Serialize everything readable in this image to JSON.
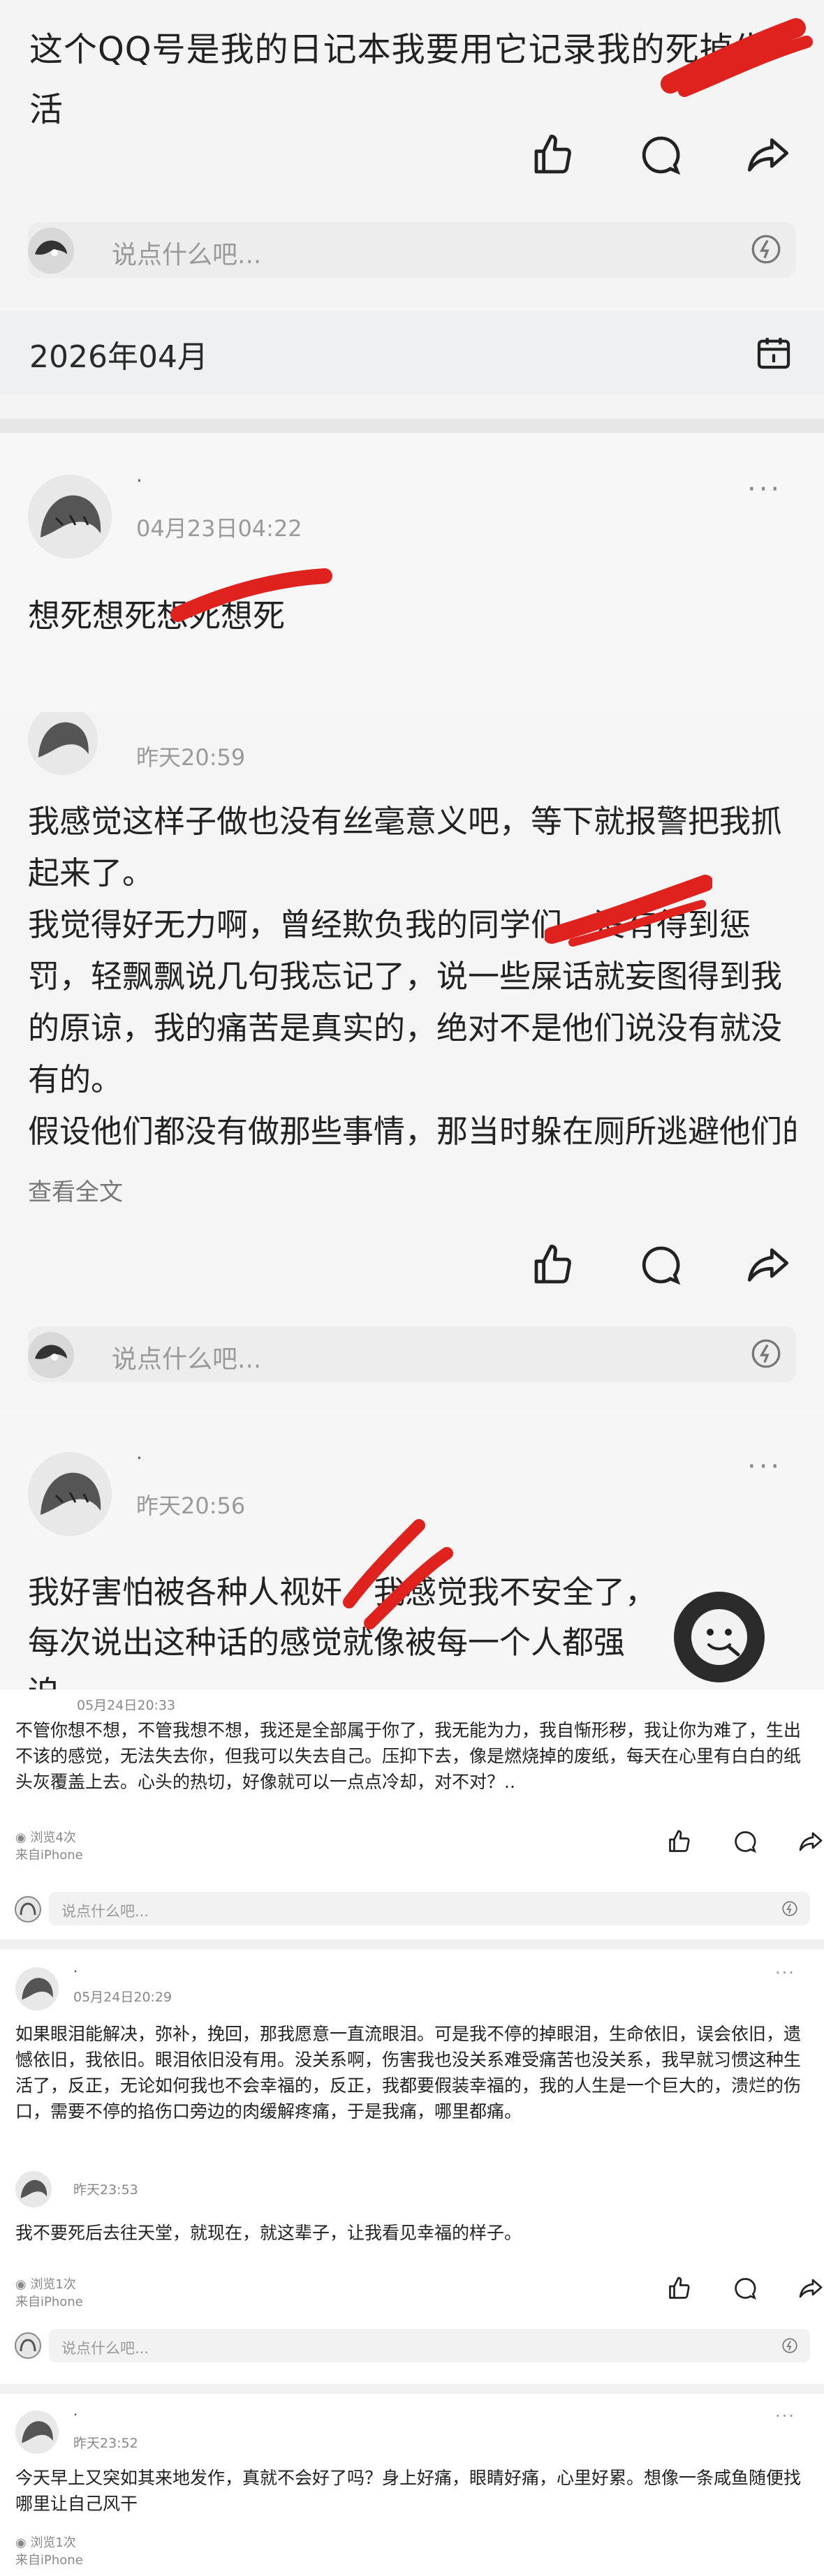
{
  "top": {
    "text": "这个QQ号是我的日记本我要用它记录我的死掉生活",
    "comment_placeholder": "说点什么吧...",
    "month": "2026年04月"
  },
  "post1": {
    "name": "·",
    "time": "04月23日04:22",
    "text": "想死想死想死想死",
    "more": "···"
  },
  "post2": {
    "time": "昨天20:59",
    "paragraphs": [
      "我感觉这样子做也没有丝毫意义吧，等下就报警把我抓起来了。",
      "我觉得好无力啊，曾经欺负我的同学们，没有得到惩罚，轻飘飘说几句我忘记了，说一些屎话就妄图得到我的原谅，我的痛苦是真实的，绝对不是他们说没有就没有的。",
      "假设他们都没有做那些事情，那当时躲在厕所逃避他们的言语攻击的人难道不是我啊，真是受..."
    ],
    "see_all": "查看全文",
    "comment_placeholder": "说点什么吧..."
  },
  "post3": {
    "name": "·",
    "time": "昨天20:56",
    "text": "我好害怕被各种人视奸，我感觉我不安全了，每次说出这种话的感觉就像被每一个人都强迫。",
    "more": "···"
  },
  "posts_small": [
    {
      "time": "05月24日20:33",
      "text": "不管你想不想，不管我想不想，我还是全部属于你了，我无能为力，我自惭形秽，我让你为难了，生出不该的感觉，无法失去你，但我可以失去自己。压抑下去，像是燃烧掉的废纸，每天在心里有白白的纸头灰覆盖上去。心头的热切，好像就可以一点点冷却，对不对？..",
      "views": "浏览4次",
      "source": "来自iPhone",
      "comment_placeholder": "说点什么吧..."
    },
    {
      "name": "·",
      "time": "05月24日20:29",
      "text": "如果眼泪能解决，弥补，挽回，那我愿意一直流眼泪。可是我不停的掉眼泪，生命依旧，误会依旧，遗憾依旧，我依旧。眼泪依旧没有用。没关系啊，伤害我也没关系难受痛苦也没关系，我早就习惯这种生活了，反正，无论如何我也不会幸福的，反正，我都要假装幸福的，我的人生是一个巨大的，溃烂的伤口，需要不停的掐伤口旁边的肉缓解疼痛，于是我痛，哪里都痛。",
      "more": "···"
    },
    {
      "time": "昨天23:53",
      "text": "我不要死后去往天堂，就现在，就这辈子，让我看见幸福的样子。",
      "views": "浏览1次",
      "source": "来自iPhone",
      "comment_placeholder": "说点什么吧..."
    },
    {
      "name": "·",
      "time": "昨天23:52",
      "text": "今天早上又突如其来地发作，真就不会好了吗？身上好痛，眼睛好痛，心里好累。想像一条咸鱼随便找哪里让自己风干",
      "views": "浏览1次",
      "source": "来自iPhone",
      "more": "···"
    }
  ],
  "icons": [
    "like-icon",
    "comment-icon",
    "share-icon",
    "emoji-icon",
    "calendar-icon",
    "avatar",
    "more-icon"
  ],
  "colors": {
    "red_scribble": "#e0221f",
    "background": "#f5f5f5",
    "placeholder": "#9a9a9a"
  }
}
